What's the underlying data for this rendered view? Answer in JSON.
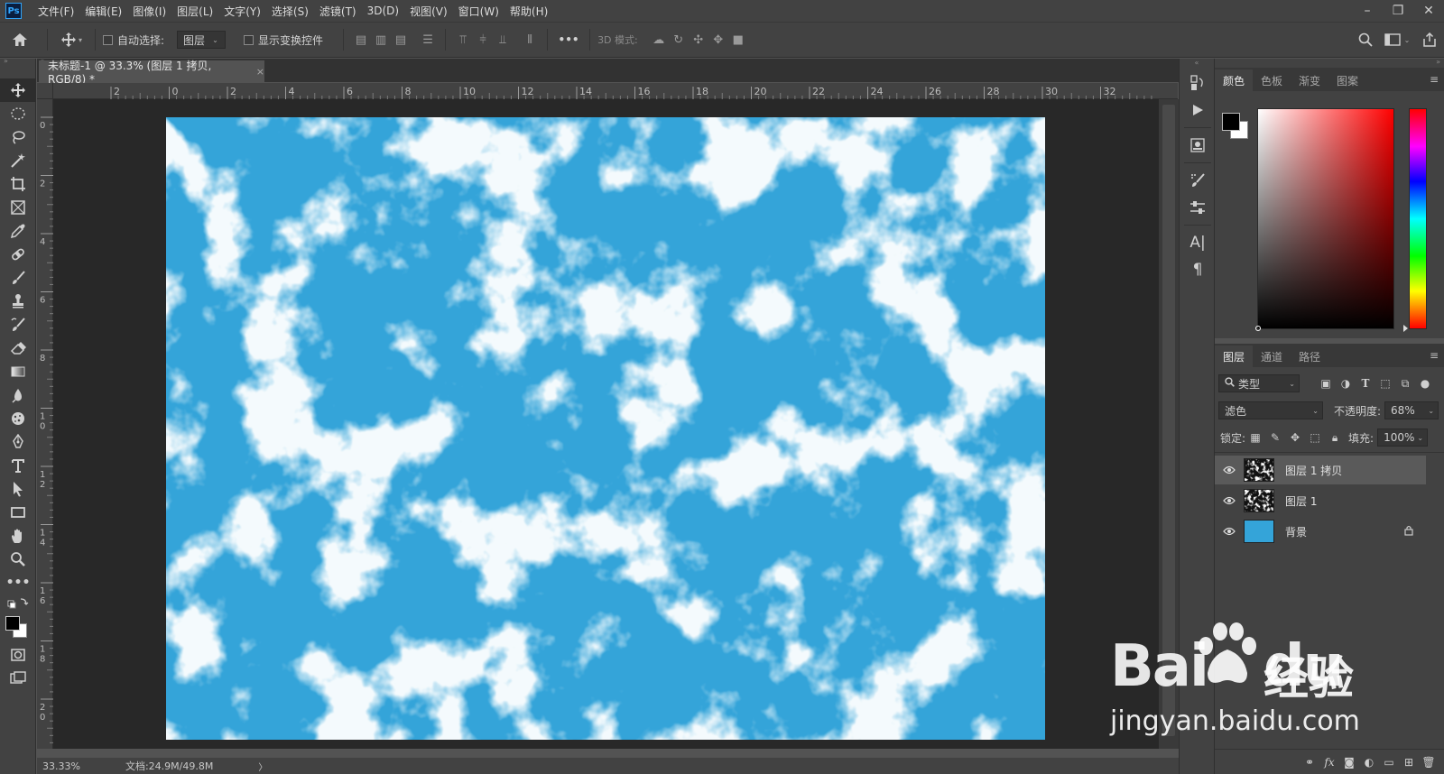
{
  "app": {
    "logo_text": "Ps",
    "menu": [
      "文件(F)",
      "编辑(E)",
      "图像(I)",
      "图层(L)",
      "文字(Y)",
      "选择(S)",
      "滤镜(T)",
      "3D(D)",
      "视图(V)",
      "窗口(W)",
      "帮助(H)"
    ]
  },
  "window_controls": {
    "minimize": "–",
    "restore": "❐",
    "close": "✕"
  },
  "options_bar": {
    "auto_select_label": "自动选择:",
    "auto_select_target": "图层",
    "show_transform_label": "显示变换控件",
    "more_label": "•••",
    "mode_3d_label": "3D 模式:"
  },
  "document": {
    "tab_title": "未标题-1 @ 33.3% (图层 1 拷贝, RGB/8) *",
    "tab_close": "×",
    "canvas_color": "#34a4d9"
  },
  "rulers": {
    "top": [
      "2",
      "0",
      "2",
      "4",
      "6",
      "8",
      "10",
      "12",
      "14",
      "16",
      "18",
      "20",
      "22",
      "24",
      "26",
      "28",
      "30",
      "32"
    ],
    "left": [
      "0",
      "2",
      "4",
      "6",
      "8",
      "1\n0",
      "1\n2",
      "1\n4",
      "1\n6",
      "1\n8",
      "2\n0"
    ]
  },
  "status": {
    "zoom": "33.33%",
    "doc_info": "文档:24.9M/49.8M",
    "arrow": "〉"
  },
  "color_panel": {
    "tabs": [
      "颜色",
      "色板",
      "渐变",
      "图案"
    ],
    "active_tab": 0,
    "foreground": "#000000",
    "background": "#ffffff"
  },
  "layers_panel": {
    "tabs": [
      "图层",
      "通道",
      "路径"
    ],
    "active_tab": 0,
    "filter_label": "类型",
    "blend_mode": "滤色",
    "opacity_label": "不透明度:",
    "opacity_value": "68%",
    "lock_label": "锁定:",
    "fill_label": "填充:",
    "fill_value": "100%",
    "layers": [
      {
        "name": "图层 1 拷贝",
        "selected": true,
        "thumb": "noise",
        "locked": false
      },
      {
        "name": "图层 1",
        "selected": false,
        "thumb": "noise",
        "locked": false
      },
      {
        "name": "背景",
        "selected": false,
        "thumb": "#34a4d9",
        "locked": true
      }
    ],
    "bottom_icons": [
      "link-icon",
      "fx-icon",
      "mask-icon",
      "adjustment-icon",
      "folder-icon",
      "new-layer-icon",
      "trash-icon"
    ]
  },
  "watermark": {
    "brand": "Bai",
    "du": "du",
    "jingyan": "经验",
    "url": "jingyan.baidu.com"
  }
}
